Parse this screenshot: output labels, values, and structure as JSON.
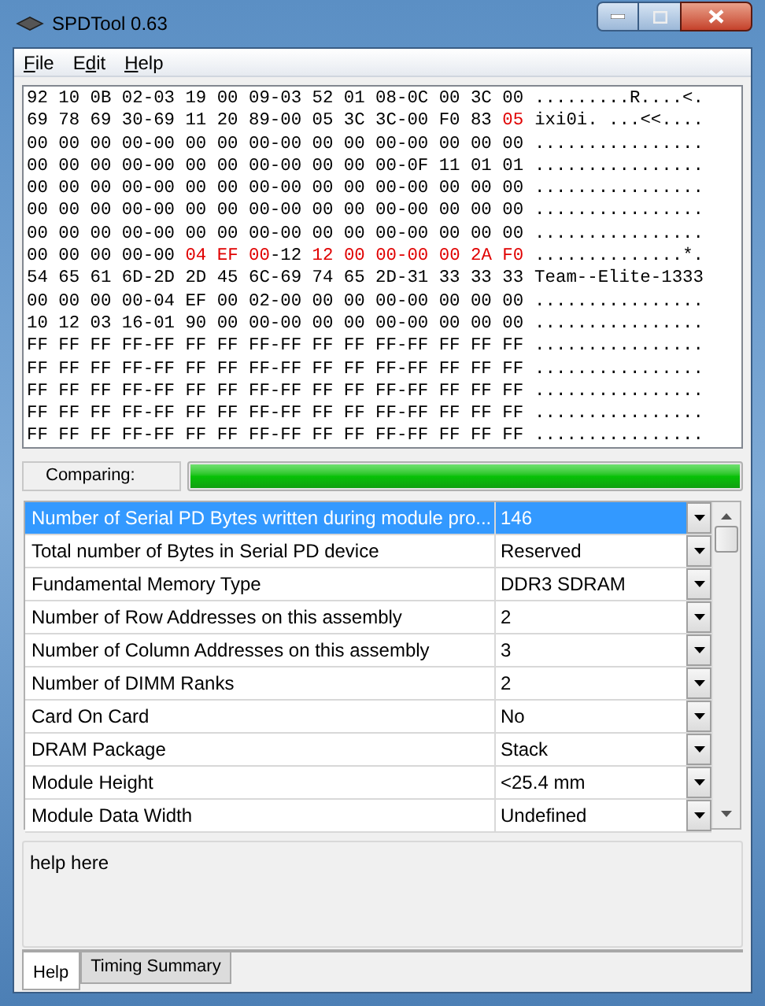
{
  "window": {
    "title": "SPDTool 0.63"
  },
  "menu": [
    {
      "key": "F",
      "after": "ile"
    },
    {
      "before": "E",
      "key": "d",
      "after": "it"
    },
    {
      "key": "H",
      "after": "elp"
    }
  ],
  "hex_rows": [
    {
      "segments": [
        {
          "text": "92 10 0B 02-03 19 00 09-03 52 01 08-0C 00 3C 00",
          "changed": false
        }
      ],
      "ascii": ".........R....<."
    },
    {
      "segments": [
        {
          "text": "69 78 69 30-69 11 20 89-00 05 3C 3C-00 F0 83 ",
          "changed": false
        },
        {
          "text": "05",
          "changed": true
        }
      ],
      "ascii": "ixi0i. ...<<...."
    },
    {
      "segments": [
        {
          "text": "00 00 00 00-00 00 00 00-00 00 00 00-00 00 00 00",
          "changed": false
        }
      ],
      "ascii": "................"
    },
    {
      "segments": [
        {
          "text": "00 00 00 00-00 00 00 00-00 00 00 00-0F 11 01 01",
          "changed": false
        }
      ],
      "ascii": "................"
    },
    {
      "segments": [
        {
          "text": "00 00 00 00-00 00 00 00-00 00 00 00-00 00 00 00",
          "changed": false
        }
      ],
      "ascii": "................"
    },
    {
      "segments": [
        {
          "text": "00 00 00 00-00 00 00 00-00 00 00 00-00 00 00 00",
          "changed": false
        }
      ],
      "ascii": "................"
    },
    {
      "segments": [
        {
          "text": "00 00 00 00-00 00 00 00-00 00 00 00-00 00 00 00",
          "changed": false
        }
      ],
      "ascii": "................"
    },
    {
      "segments": [
        {
          "text": "00 00 00 00-00 ",
          "changed": false
        },
        {
          "text": "04 EF 00",
          "changed": true
        },
        {
          "text": "-12 ",
          "changed": false
        },
        {
          "text": "12 00 00-00 00 2A F0",
          "changed": true
        }
      ],
      "ascii": "..............*."
    },
    {
      "segments": [
        {
          "text": "54 65 61 6D-2D 2D 45 6C-69 74 65 2D-31 33 33 33",
          "changed": false
        }
      ],
      "ascii": "Team--Elite-1333"
    },
    {
      "segments": [
        {
          "text": "00 00 00 00-04 EF 00 02-00 00 00 00-00 00 00 00",
          "changed": false
        }
      ],
      "ascii": "................"
    },
    {
      "segments": [
        {
          "text": "10 12 03 16-01 90 00 00-00 00 00 00-00 00 00 00",
          "changed": false
        }
      ],
      "ascii": "................"
    },
    {
      "segments": [
        {
          "text": "FF FF FF FF-FF FF FF FF-FF FF FF FF-FF FF FF FF",
          "changed": false
        }
      ],
      "ascii": "................"
    },
    {
      "segments": [
        {
          "text": "FF FF FF FF-FF FF FF FF-FF FF FF FF-FF FF FF FF",
          "changed": false
        }
      ],
      "ascii": "................"
    },
    {
      "segments": [
        {
          "text": "FF FF FF FF-FF FF FF FF-FF FF FF FF-FF FF FF FF",
          "changed": false
        }
      ],
      "ascii": "................"
    },
    {
      "segments": [
        {
          "text": "FF FF FF FF-FF FF FF FF-FF FF FF FF-FF FF FF FF",
          "changed": false
        }
      ],
      "ascii": "................"
    },
    {
      "segments": [
        {
          "text": "FF FF FF FF-FF FF FF FF-FF FF FF FF-FF FF FF FF",
          "changed": false
        }
      ],
      "ascii": "................"
    }
  ],
  "status": {
    "label": "Comparing:",
    "level": 1
  },
  "properties": [
    {
      "name": "Number of Serial PD Bytes written during module pro...",
      "value": "146",
      "selected": true
    },
    {
      "name": "Total number of Bytes in Serial PD device",
      "value": "Reserved",
      "selected": false
    },
    {
      "name": "Fundamental Memory Type",
      "value": "DDR3 SDRAM",
      "selected": false
    },
    {
      "name": "Number of Row Addresses on this assembly",
      "value": "2",
      "selected": false
    },
    {
      "name": "Number of Column Addresses on this assembly",
      "value": "3",
      "selected": false
    },
    {
      "name": "Number of DIMM Ranks",
      "value": "2",
      "selected": false
    },
    {
      "name": "Card On Card",
      "value": "No",
      "selected": false
    },
    {
      "name": "DRAM Package",
      "value": "Stack",
      "selected": false
    },
    {
      "name": "Module Height",
      "value": "<25.4 mm",
      "selected": false
    },
    {
      "name": "Module Data Width",
      "value": "Undefined",
      "selected": false
    }
  ],
  "help_text": "help here",
  "tabs": [
    {
      "label": "Help",
      "selected": true
    },
    {
      "label": "Timing Summary",
      "selected": false
    }
  ]
}
